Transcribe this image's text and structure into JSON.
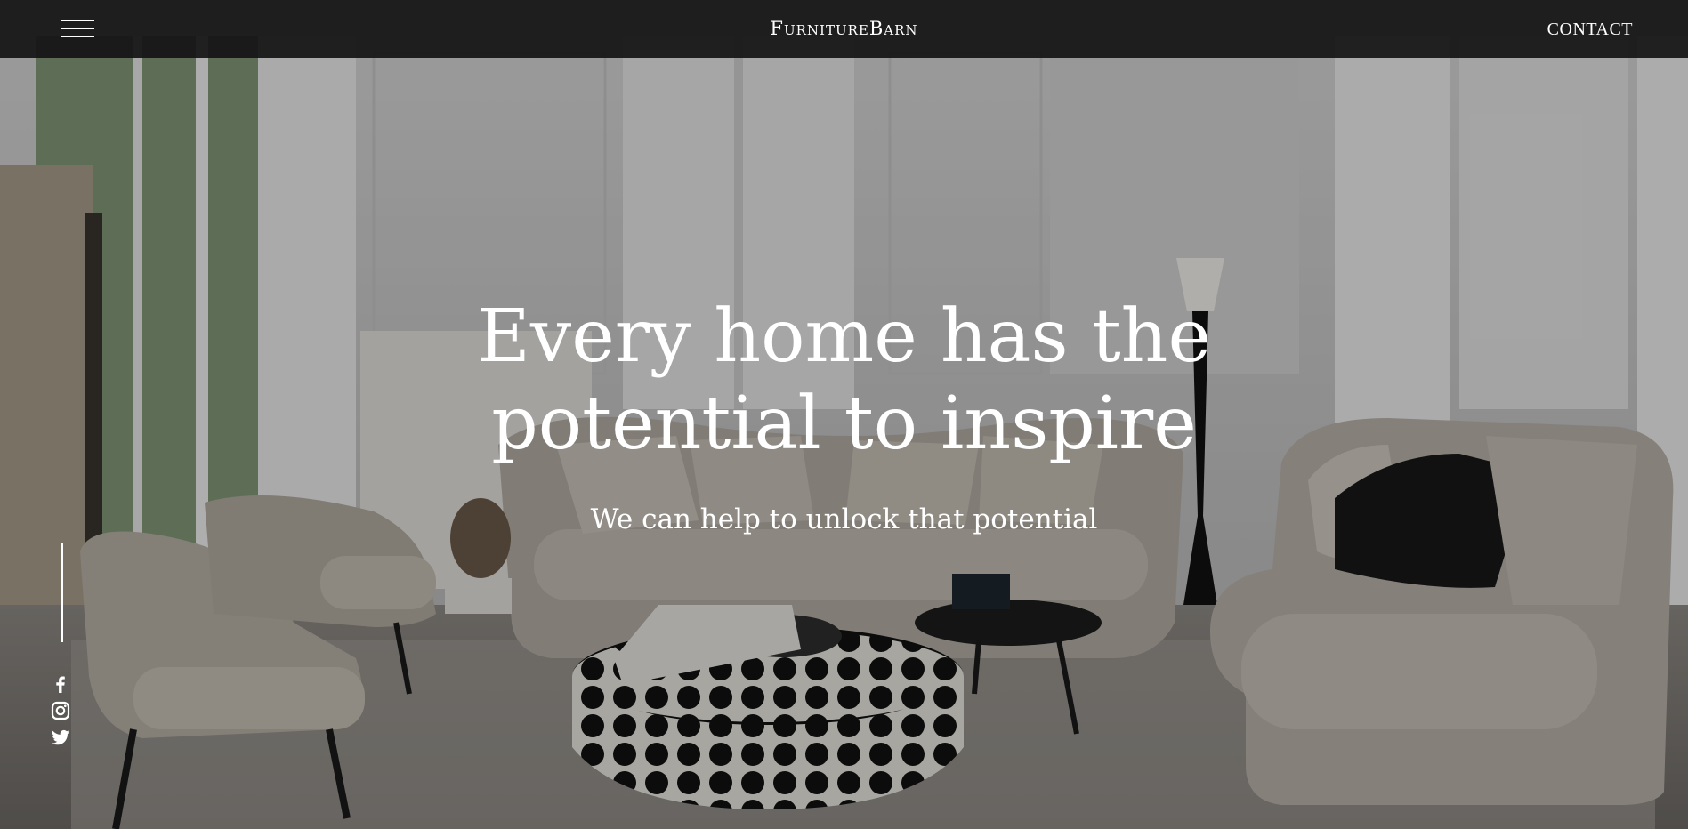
{
  "header": {
    "brand": "FurnitureBarn",
    "contact_label": "CONTACT",
    "menu_icon": "hamburger-menu-icon"
  },
  "hero": {
    "headline_line1": "Every home has the",
    "headline_line2": "potential to inspire",
    "subheadline": "We can help to unlock that potential",
    "background_image": "living-room-sofa-photo"
  },
  "social": {
    "items": [
      {
        "icon": "facebook-icon"
      },
      {
        "icon": "instagram-icon"
      },
      {
        "icon": "twitter-icon"
      }
    ]
  },
  "colors": {
    "topbar": "#141414",
    "text": "#ffffff"
  }
}
